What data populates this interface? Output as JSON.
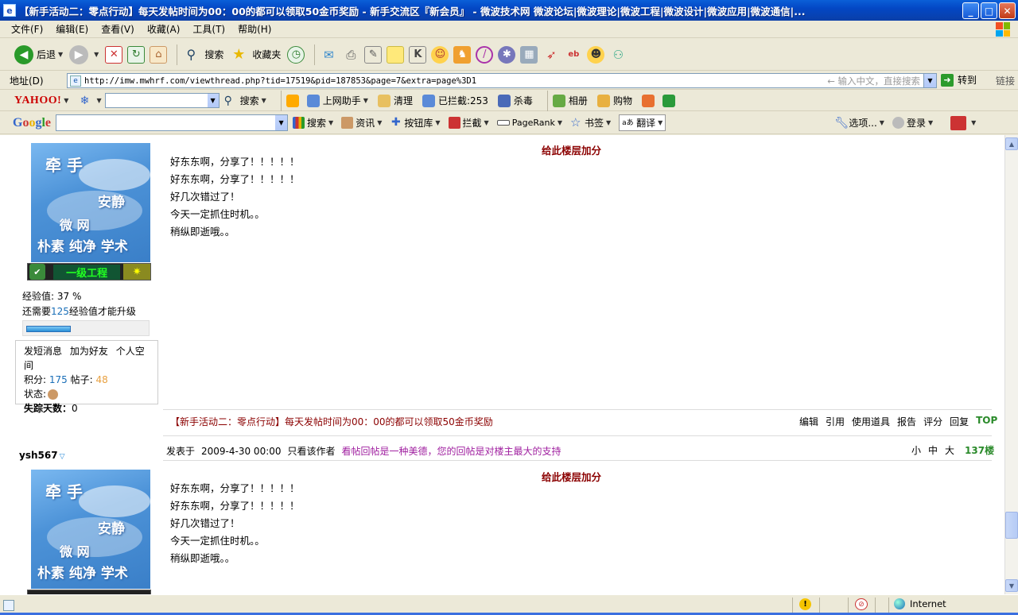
{
  "window": {
    "title": "【新手活动二：零点行动】每天发帖时间为00：00的都可以领取50金币奖励 - 新手交流区『新会员』 - 微波技术网 微波论坛|微波理论|微波工程|微波设计|微波应用|微波通信|...",
    "buttons": {
      "minimize": "_",
      "maximize": "□",
      "close": "✕"
    }
  },
  "menu": [
    "文件(F)",
    "编辑(E)",
    "查看(V)",
    "收藏(A)",
    "工具(T)",
    "帮助(H)"
  ],
  "toolbar": {
    "back": "后退",
    "search": "搜索",
    "favorites": "收藏夹"
  },
  "address": {
    "label": "地址(D)",
    "url": "http://imw.mwhrf.com/viewthread.php?tid=17519&pid=187853&page=7&extra=page%3D1",
    "hint": "← 输入中文，直接搜索",
    "go": "转到",
    "links": "链接"
  },
  "yahoo": {
    "logo": "YAHOO!",
    "search": "搜索",
    "assistant": "上网助手",
    "clean": "清理",
    "blocked": "已拦截:253",
    "antivirus": "杀毒",
    "album": "相册",
    "shopping": "购物"
  },
  "google": {
    "logo": "Google",
    "search": "搜索",
    "news": "资讯",
    "buttons": "按钮库",
    "block": "拦截",
    "pagerank": "PageRank",
    "bookmarks": "书签",
    "translate": "翻译",
    "options": "选项...",
    "login": "登录"
  },
  "post1": {
    "rank": "一级工程",
    "exp_label": "经验值: 37 %",
    "exp_percent": 37,
    "need_prefix": "还需要",
    "need_value": "125",
    "need_suffix": "经验值才能升级",
    "links": [
      "发短消息",
      "加为好友",
      "个人空间"
    ],
    "score_label": "积分:",
    "score": "175",
    "posts_label": "帖子:",
    "posts": "48",
    "status_label": "状态:",
    "missing_label": "失踪天数：",
    "missing_value": "0",
    "rate_title": "给此楼层加分",
    "body": [
      "好东东啊，分享了！！！！！",
      "好东东啊，分享了！！！！！",
      "好几次错过了！",
      "今天一定抓住时机。。",
      "稍纵即逝哦。。"
    ],
    "signature": "【新手活动二：零点行动】每天发帖时间为00：00的都可以领取50金币奖励",
    "actions": [
      "编辑",
      "引用",
      "使用道具",
      "报告",
      "评分",
      "回复"
    ],
    "top": "TOP"
  },
  "post2": {
    "username": "ysh567",
    "posted_at_label": "发表于",
    "posted_at": "2009-4-30 00:00",
    "only_author": "只看该作者",
    "slogan": "看帖回帖是一种美德，您的回帖是对楼主最大的支持",
    "sizes": [
      "小",
      "中",
      "大"
    ],
    "floor": "137楼",
    "rate_title": "给此楼层加分",
    "body": [
      "好东东啊，分享了！！！！！",
      "好东东啊，分享了！！！！！",
      "好几次错过了！",
      "今天一定抓住时机。。",
      "稍纵即逝哦。。"
    ]
  },
  "avatar_text": {
    "line1": "牵  手",
    "line2": "安静",
    "line3": "微  网",
    "line4": "朴素 纯净 学术"
  },
  "status": {
    "zone": "Internet"
  },
  "colors": {
    "title_red": "#8b0000",
    "top_green": "#2a8a2a",
    "slogan_purple": "#a020a0",
    "link_blue": "#1a6fb8"
  }
}
